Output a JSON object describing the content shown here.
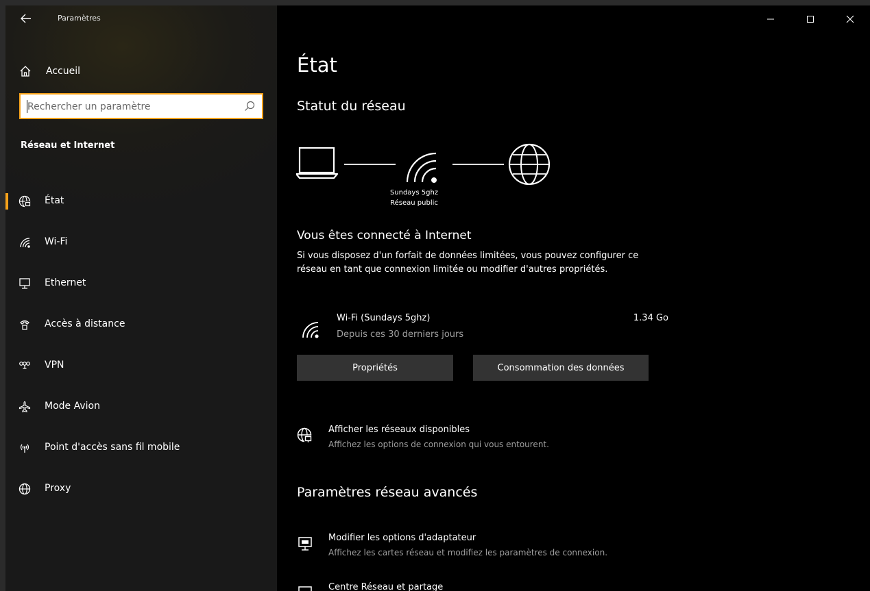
{
  "window": {
    "app_title": "Paramètres",
    "controls": {
      "minimize_icon": "minimize-icon",
      "maximize_icon": "maximize-icon",
      "close_icon": "close-icon"
    }
  },
  "sidebar": {
    "home_label": "Accueil",
    "search_placeholder": "Rechercher un paramètre",
    "section_title": "Réseau et Internet",
    "accent_color": "#f7a21a",
    "items": [
      {
        "label": "État",
        "icon": "status-globe-icon",
        "active": true
      },
      {
        "label": "Wi-Fi",
        "icon": "wifi-icon"
      },
      {
        "label": "Ethernet",
        "icon": "ethernet-icon"
      },
      {
        "label": "Accès à distance",
        "icon": "dialup-icon"
      },
      {
        "label": "VPN",
        "icon": "vpn-icon"
      },
      {
        "label": "Mode Avion",
        "icon": "airplane-icon"
      },
      {
        "label": "Point d'accès sans fil mobile",
        "icon": "hotspot-icon"
      },
      {
        "label": "Proxy",
        "icon": "globe-icon"
      }
    ]
  },
  "main": {
    "title": "État",
    "network_status_heading": "Statut du réseau",
    "diagram": {
      "ssid": "Sundays 5ghz",
      "network_type": "Réseau public"
    },
    "connected_title": "Vous êtes connecté à Internet",
    "connected_desc": "Si vous disposez d'un forfait de données limitées, vous pouvez configurer ce réseau en tant que connexion limitée ou modifier d'autres propriétés.",
    "wifi": {
      "name": "Wi-Fi (Sundays 5ghz)",
      "period": "Depuis ces 30 derniers jours",
      "usage": "1.34 Go"
    },
    "buttons": {
      "properties": "Propriétés",
      "data_usage": "Consommation des données"
    },
    "available_networks": {
      "title": "Afficher les réseaux disponibles",
      "desc": "Affichez les options de connexion qui vous entourent."
    },
    "advanced_heading": "Paramètres réseau avancés",
    "adapter_options": {
      "title": "Modifier les options d'adaptateur",
      "desc": "Affichez les cartes réseau et modifiez les paramètres de connexion."
    },
    "network_center": {
      "title": "Centre Réseau et partage"
    }
  }
}
